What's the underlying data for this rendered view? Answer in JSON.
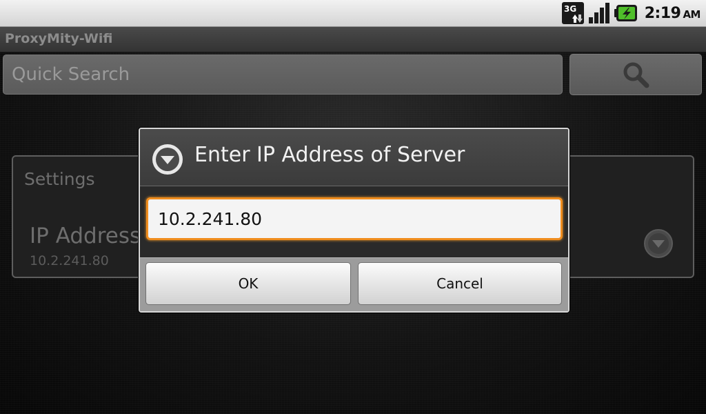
{
  "status_bar": {
    "network_icon": "3g-data-icon",
    "signal_icon": "signal-strength-icon",
    "battery_icon": "battery-charging-icon",
    "time": "2:19",
    "ampm": "AM"
  },
  "app": {
    "title": "ProxyMity-Wifi"
  },
  "search": {
    "placeholder": "Quick Search",
    "button_icon": "search-icon"
  },
  "settings": {
    "heading": "Settings",
    "preference": {
      "title": "IP Address of Server",
      "summary": "10.2.241.80"
    }
  },
  "dialog": {
    "icon": "dropdown-circle-icon",
    "title": "Enter IP Address of Server",
    "input_value": "10.2.241.80",
    "ok_label": "OK",
    "cancel_label": "Cancel"
  },
  "colors": {
    "focus_accent": "#f08d1e",
    "dialog_title": "#f2f2f2"
  }
}
